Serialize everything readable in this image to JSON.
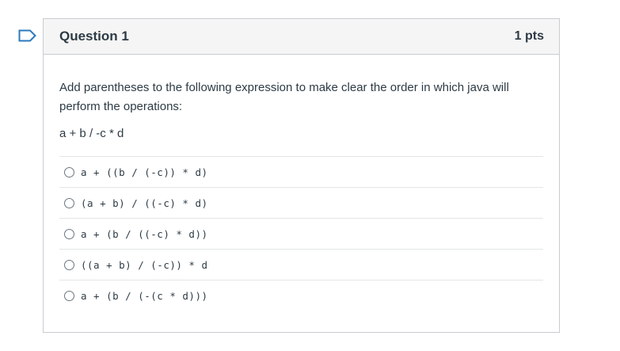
{
  "question": {
    "title": "Question 1",
    "points": "1 pts",
    "text": "Add parentheses to the following expression to make clear the order in which java will perform the operations:",
    "expression": "a + b / -c * d"
  },
  "answers": [
    {
      "label": "a + ((b / (-c)) * d)"
    },
    {
      "label": "(a + b) / ((-c) * d)"
    },
    {
      "label": "a + (b / ((-c) * d))"
    },
    {
      "label": "((a + b) / (-c)) * d"
    },
    {
      "label": "a + (b / (-(c * d)))"
    }
  ],
  "colors": {
    "border": "#c7cdd1",
    "header_bg": "#f5f5f5",
    "flag": "#2b7abc",
    "text": "#2d3b45"
  },
  "icons": {
    "flag": "bookmark-flag-icon"
  }
}
